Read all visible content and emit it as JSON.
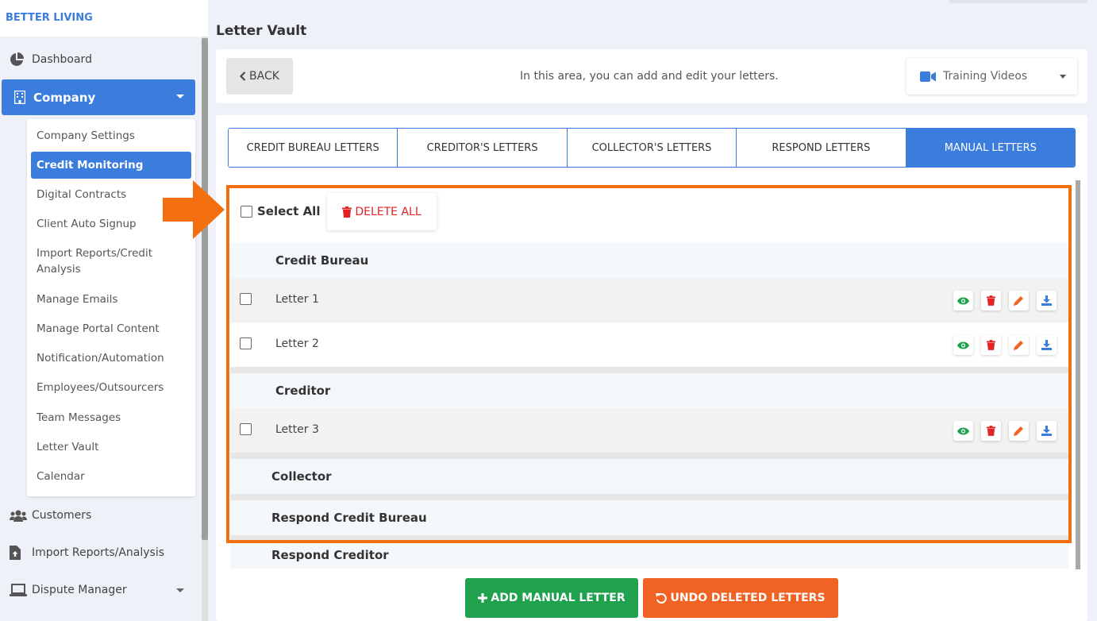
{
  "brand": "BETTER LIVING",
  "sidebar": {
    "dashboard": "Dashboard",
    "company": "Company",
    "company_items": [
      "Company Settings",
      "Credit Monitoring",
      "Digital Contracts",
      "Client Auto Signup",
      "Import Reports/Credit Analysis",
      "Manage Emails",
      "Manage Portal Content",
      "Notification/Automation",
      "Employees/Outsourcers",
      "Team Messages",
      "Letter Vault",
      "Calendar"
    ],
    "active_item": "Credit Monitoring",
    "customers": "Customers",
    "import_reports": "Import Reports/Analysis",
    "dispute_manager": "Dispute Manager"
  },
  "page": {
    "title": "Letter Vault",
    "back_label": "BACK",
    "info": "In this area, you can add and edit your letters.",
    "training_label": "Training Videos"
  },
  "tabs": [
    "CREDIT BUREAU LETTERS",
    "CREDITOR'S LETTERS",
    "COLLECTOR'S LETTERS",
    "RESPOND LETTERS",
    "MANUAL LETTERS"
  ],
  "active_tab": "MANUAL LETTERS",
  "list": {
    "select_all": "Select All",
    "delete_all": "DELETE ALL",
    "sections": {
      "credit_bureau": "Credit Bureau",
      "creditor": "Creditor",
      "collector": "Collector",
      "respond_credit_bureau": "Respond Credit Bureau",
      "respond_creditor": "Respond Creditor"
    },
    "letters": [
      "Letter 1",
      "Letter 2",
      "Letter 3"
    ]
  },
  "buttons": {
    "add_manual": "ADD MANUAL LETTER",
    "undo_deleted": "UNDO DELETED LETTERS"
  },
  "colors": {
    "primary": "#3b7ddd",
    "highlight": "#f36f10",
    "add": "#1fa14e",
    "undo": "#f06323",
    "delete": "#e02424",
    "view": "#1fa14e",
    "edit": "#f06323",
    "download": "#3b7ddd"
  },
  "icons": {
    "view": "eye-icon",
    "delete": "trash-icon",
    "edit": "pencil-icon",
    "download": "download-icon"
  }
}
